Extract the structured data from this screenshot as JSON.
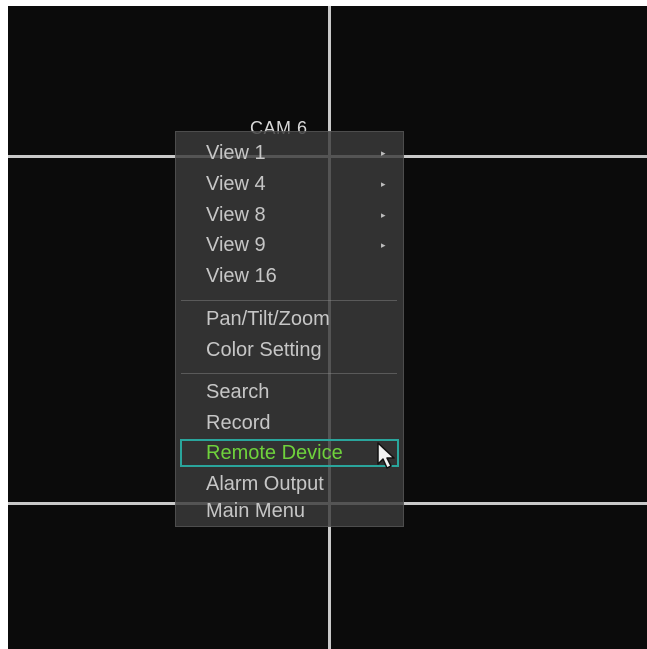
{
  "camera_label": "CAM 6",
  "menu": {
    "groups": [
      [
        {
          "label": "View 1",
          "has_submenu": true
        },
        {
          "label": "View 4",
          "has_submenu": true
        },
        {
          "label": "View 8",
          "has_submenu": true
        },
        {
          "label": "View 9",
          "has_submenu": true
        },
        {
          "label": "View 16",
          "has_submenu": false
        }
      ],
      [
        {
          "label": "Pan/Tilt/Zoom",
          "has_submenu": false
        },
        {
          "label": "Color Setting",
          "has_submenu": false
        }
      ],
      [
        {
          "label": "Search",
          "has_submenu": false
        },
        {
          "label": "Record",
          "has_submenu": false
        },
        {
          "label": "Remote Device",
          "has_submenu": false,
          "selected": true
        },
        {
          "label": "Alarm Output",
          "has_submenu": false
        },
        {
          "label": "Main Menu",
          "has_submenu": false
        }
      ]
    ],
    "submenu_glyph": "▸"
  },
  "colors": {
    "background": "#0b0b0b",
    "grid_lines": "#c9c9c9",
    "menu_text": "#c6c6c6",
    "selected_text": "#6fd23c",
    "selected_border": "#2aa59c"
  },
  "icons": {
    "cursor": "mouse-pointer-icon",
    "submenu": "chevron-right-icon"
  }
}
